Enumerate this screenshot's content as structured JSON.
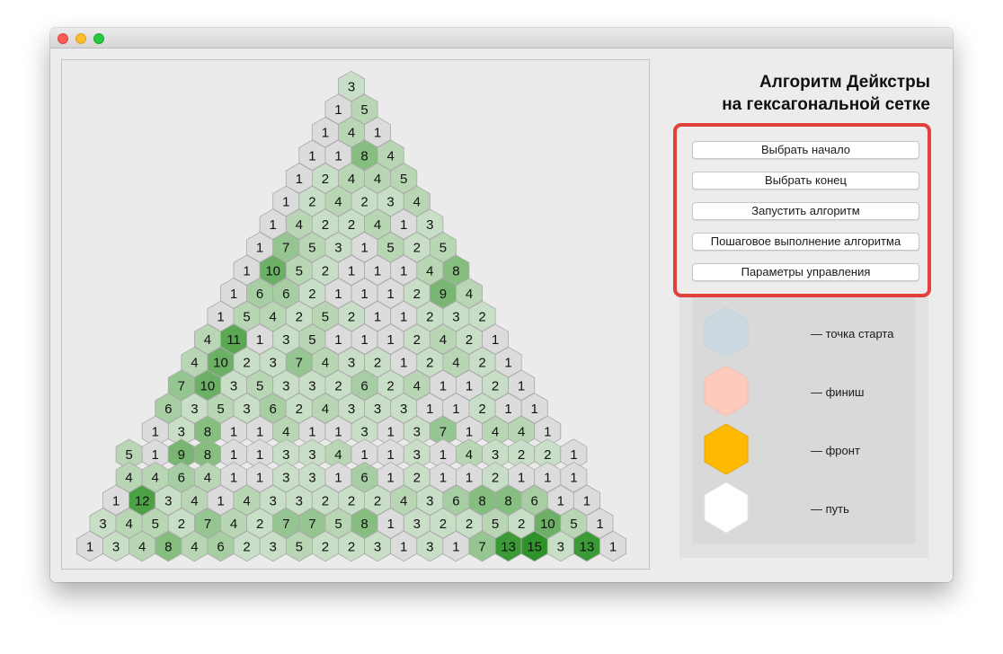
{
  "window": {
    "traffic_lights": [
      "close",
      "minimize",
      "zoom"
    ]
  },
  "title": {
    "line1": "Алгоритм Дейкстры",
    "line2": "на гексагональной сетке"
  },
  "buttons": {
    "select_start": "Выбрать начало",
    "select_end": "Выбрать конец",
    "run": "Запустить алгоритм",
    "step": "Пошаговое выполнение алгоритма",
    "params": "Параметры управления"
  },
  "legend": [
    {
      "label": "— точка старта",
      "color": "#ccd8e0"
    },
    {
      "label": "— финиш",
      "color": "#fdcbbb"
    },
    {
      "label": "— фронт",
      "color": "#fdba00"
    },
    {
      "label": "— путь",
      "color": "#ffffff"
    }
  ],
  "grid": {
    "colors": {
      "1": "#dcdcdc",
      "2": "#c9dec6",
      "3": "#c9dec6",
      "4": "#b8d5b4",
      "5": "#b8d5b4",
      "6": "#a7cda2",
      "7": "#95c590",
      "8": "#86be80",
      "9": "#7ab673",
      "10": "#6cb065",
      "11": "#5aa852",
      "12": "#4ba144",
      "13": "#3b9a35",
      "15": "#2e932b"
    },
    "rows": [
      [
        3
      ],
      [
        1,
        5
      ],
      [
        1,
        4,
        1
      ],
      [
        1,
        1,
        8,
        4
      ],
      [
        1,
        2,
        4,
        4,
        5
      ],
      [
        1,
        2,
        4,
        2,
        3,
        4
      ],
      [
        1,
        4,
        2,
        2,
        4,
        1,
        3
      ],
      [
        1,
        7,
        5,
        3,
        1,
        5,
        2,
        5
      ],
      [
        1,
        10,
        5,
        2,
        1,
        1,
        1,
        4,
        8
      ],
      [
        1,
        6,
        6,
        2,
        1,
        1,
        1,
        2,
        9,
        4
      ],
      [
        1,
        5,
        4,
        2,
        5,
        2,
        1,
        1,
        2,
        3,
        2
      ],
      [
        4,
        11,
        1,
        3,
        5,
        1,
        1,
        1,
        2,
        4,
        2,
        1
      ],
      [
        4,
        10,
        2,
        3,
        7,
        4,
        3,
        2,
        1,
        2,
        4,
        2,
        1
      ],
      [
        7,
        10,
        3,
        5,
        3,
        3,
        2,
        6,
        2,
        4,
        1,
        1,
        2,
        1
      ],
      [
        6,
        3,
        5,
        3,
        6,
        2,
        4,
        3,
        3,
        3,
        1,
        1,
        2,
        1,
        1
      ],
      [
        1,
        3,
        8,
        1,
        1,
        4,
        1,
        1,
        3,
        1,
        3,
        7,
        1,
        4,
        4,
        1
      ],
      [
        5,
        1,
        9,
        8,
        1,
        1,
        3,
        3,
        4,
        1,
        1,
        3,
        1,
        4,
        3,
        2,
        2,
        1
      ],
      [
        4,
        4,
        6,
        4,
        1,
        1,
        3,
        3,
        1,
        6,
        1,
        2,
        1,
        1,
        2,
        1,
        1,
        1
      ],
      [
        1,
        12,
        3,
        4,
        1,
        4,
        3,
        3,
        2,
        2,
        2,
        4,
        3,
        6,
        8,
        8,
        6,
        1,
        1
      ],
      [
        3,
        4,
        5,
        2,
        7,
        4,
        2,
        7,
        7,
        5,
        8,
        1,
        3,
        2,
        2,
        5,
        2,
        10,
        5,
        1
      ],
      [
        1,
        3,
        4,
        8,
        4,
        6,
        2,
        3,
        5,
        2,
        2,
        3,
        1,
        3,
        1,
        7,
        13,
        15,
        3,
        13,
        1
      ]
    ]
  }
}
